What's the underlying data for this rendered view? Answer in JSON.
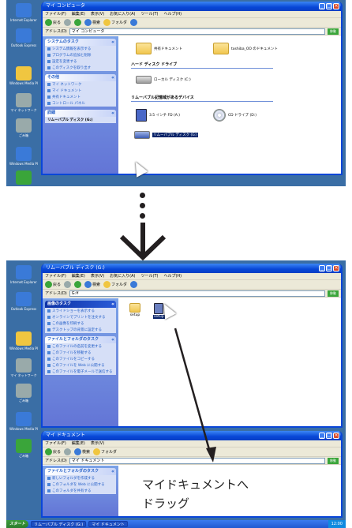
{
  "top_screenshot": {
    "desktop_icons": [
      "Internet Explorer",
      "Outlook Express",
      "Windows Media Player",
      "マイ ネットワーク",
      "ごみ箱",
      "Windows Media Player",
      "ごみ箱"
    ],
    "window": {
      "title": "マイ コンピュータ",
      "menu": [
        "ファイル(F)",
        "編集(E)",
        "表示(V)",
        "お気に入り(A)",
        "ツール(T)",
        "ヘルプ(H)"
      ],
      "toolbar": {
        "back": "戻る",
        "search": "検索",
        "folders": "フォルダ"
      },
      "address_label": "アドレス(D)",
      "address_value": "マイ コンピュータ",
      "go_label": "移動",
      "tasks": {
        "system": {
          "title": "システムのタスク",
          "items": [
            "システム情報を表示する",
            "プログラムの追加と削除",
            "設定を変更する",
            "このディスクを取り出す"
          ]
        },
        "other": {
          "title": "その他",
          "items": [
            "マイ ネットワーク",
            "マイ ドキュメント",
            "共有ドキュメント",
            "コントロール パネル"
          ]
        },
        "details": {
          "title": "詳細",
          "subtitle": "リムーバブル ディスク (G:)"
        }
      },
      "content": {
        "shared_doc": "共有ドキュメント",
        "user_doc": "toshiba_OO のドキュメント",
        "hdd_header": "ハード ディスク ドライブ",
        "hdd_item": "ローカル ディスク (C:)",
        "removable_header": "リムーバブル記憶域があるデバイス",
        "floppy": "3.5 インチ FD (A:)",
        "cd": "CD ドライブ (D:)",
        "removable_selected": "リムーバブル ディスク (G:)"
      }
    }
  },
  "bottom_screenshot": {
    "upper_window": {
      "title": "リムーバブル ディスク (G:)",
      "menu": [
        "ファイル(F)",
        "編集(E)",
        "表示(V)",
        "お気に入り(A)",
        "ツール(T)",
        "ヘルプ(H)"
      ],
      "toolbar": {
        "back": "戻る",
        "search": "検索",
        "folders": "フォルダ"
      },
      "address_label": "アドレス(D)",
      "address_value": "G:¥",
      "go_label": "移動",
      "tasks": {
        "image": {
          "title": "画像のタスク",
          "items": [
            "スライドショーを表示する",
            "オンラインでプリントを注文する",
            "この画像を印刷する",
            "デスクトップの背景に設定する"
          ]
        },
        "file": {
          "title": "ファイルとフォルダのタスク",
          "items": [
            "このファイルの名前を変更する",
            "このファイルを移動する",
            "このファイルをコピーする",
            "このファイルを Web に公開する",
            "このファイルを電子メールで送信する"
          ]
        }
      },
      "content": {
        "folder_label": "setup",
        "file_label": "setup"
      }
    },
    "lower_window": {
      "title": "マイ ドキュメント",
      "address_label": "アドレス(D)",
      "address_value": "マイ ドキュメント",
      "go_label": "移動",
      "tasks": {
        "file": {
          "title": "ファイルとフォルダのタスク",
          "items": [
            "新しいフォルダを作成する",
            "このフォルダを Web に公開する",
            "このフォルダを共有する"
          ]
        }
      }
    },
    "taskbar": {
      "start": "スタート",
      "buttons": [
        "リムーバブル ディスク (G:)",
        "マイ ドキュメント"
      ],
      "tray": "12:00"
    },
    "annotation": {
      "line1": "マイドキュメントへ",
      "line2": "ドラッグ"
    }
  },
  "colors": {
    "desktop": "#3a6ea5",
    "title": "#0746d6",
    "arrow": "#231f20"
  }
}
